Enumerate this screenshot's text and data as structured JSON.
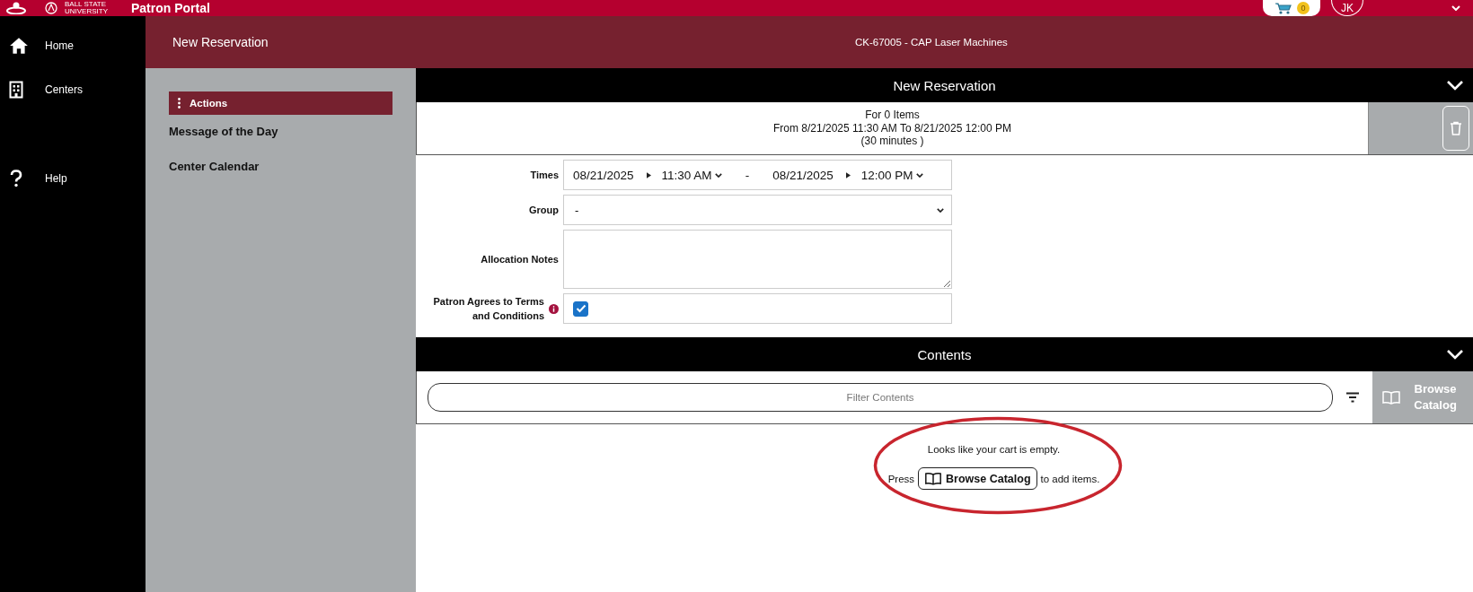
{
  "header": {
    "university": "BALL STATE UNIVERSITY",
    "title": "Patron Portal",
    "cart_count": "0",
    "avatar": "JK"
  },
  "nav": [
    {
      "label": "Home"
    },
    {
      "label": "Centers"
    },
    {
      "label": "Help"
    }
  ],
  "page": {
    "title": "New Reservation",
    "center": "CK-67005 - CAP Laser Machines"
  },
  "actions": {
    "title": "Actions",
    "items": [
      "Message of the Day",
      "Center Calendar"
    ]
  },
  "reservation": {
    "title": "New Reservation",
    "expanded": true,
    "summary": [
      "For 0 Items",
      "From 8/21/2025 11:30 AM To 8/21/2025 12:00 PM",
      "(30 minutes )"
    ],
    "fields": [
      {
        "kind": "times",
        "label": "Times",
        "start_date": "08/21/2025",
        "start_time": "11:30 AM",
        "separator": "-",
        "end_date": "08/21/2025",
        "end_time": "12:00 PM"
      },
      {
        "kind": "select",
        "label": "Group",
        "value": "-"
      },
      {
        "kind": "textarea",
        "label": "Allocation Notes"
      },
      {
        "kind": "checkbox",
        "label": "Patron Agrees to Terms and Conditions",
        "info": true,
        "checked": true
      }
    ]
  },
  "contents": {
    "title": "Contents",
    "expanded": true,
    "filter_placeholder": "Filter Contents",
    "browse_label": "Browse Catalog",
    "empty_message": "Looks like your cart is empty.",
    "press_before": "Press",
    "press_button": "Browse Catalog",
    "press_after": "to add items."
  },
  "annotation": {
    "circled": true
  }
}
